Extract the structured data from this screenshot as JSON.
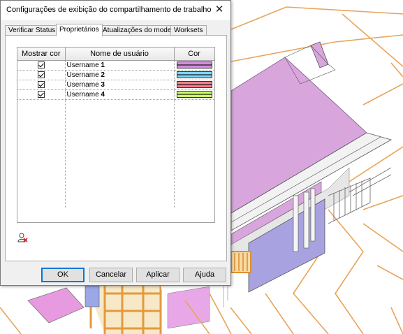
{
  "dialog": {
    "title": "Configurações de exibição do compartilhamento de trabalho",
    "tabs": [
      {
        "label": "Verificar Status"
      },
      {
        "label": "Proprietários"
      },
      {
        "label": "Atualizações do modelo"
      },
      {
        "label": "Worksets"
      }
    ],
    "active_tab": "Proprietários",
    "table": {
      "columns": [
        "Mostrar cor",
        "Nome de usuário",
        "Cor"
      ],
      "rows": [
        {
          "show": true,
          "name_prefix": "Username ",
          "name_number": "1",
          "color": "#d48ede"
        },
        {
          "show": true,
          "name_prefix": "Username ",
          "name_number": "2",
          "color": "#7fd4f5"
        },
        {
          "show": true,
          "name_prefix": "Username ",
          "name_number": "3",
          "color": "#f57e8c"
        },
        {
          "show": true,
          "name_prefix": "Username ",
          "name_number": "4",
          "color": "#ccff66"
        }
      ]
    },
    "buttons": {
      "ok": "OK",
      "cancel": "Cancelar",
      "apply": "Aplicar",
      "help": "Ajuda"
    },
    "icons": {
      "close": "close-icon",
      "remove_user": "remove-user-icon"
    }
  },
  "colors": {
    "roof_magenta": "#d8a6dd",
    "wall_purple": "#a8a2e0",
    "frame_orange": "#f4a640",
    "contour_orange": "#e8a45a",
    "focus_blue": "#0078d7"
  }
}
